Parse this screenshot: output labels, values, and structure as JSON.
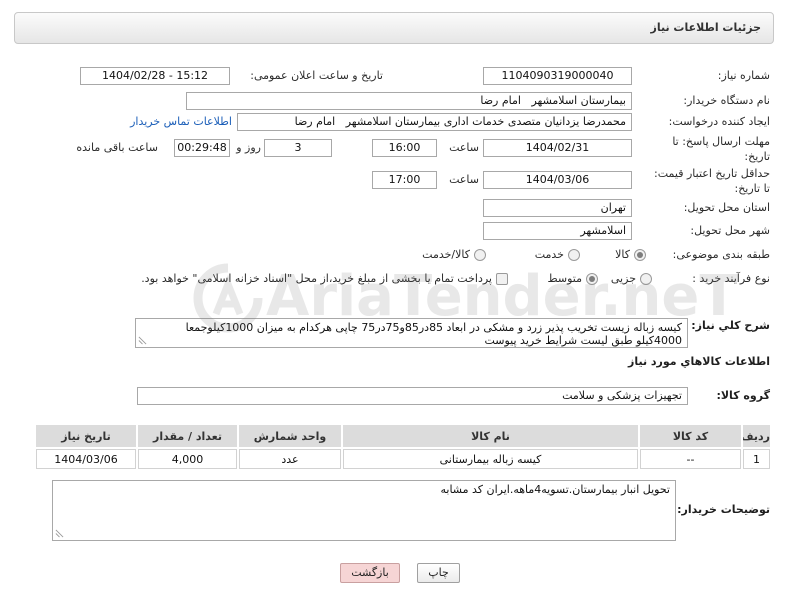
{
  "page": {
    "title": "جزئیات اطلاعات نیاز",
    "watermark": "AriaTender.neT"
  },
  "fields": {
    "need_number": {
      "label": "شماره نیاز:",
      "value": "1104090319000040"
    },
    "announce_datetime": {
      "label": "تاریخ و ساعت اعلان عمومی:",
      "value": "1404/02/28 - 15:12"
    },
    "buyer_org": {
      "label": "نام دستگاه خریدار:",
      "value": "بیمارستان اسلامشهر   امام رضا"
    },
    "requester": {
      "label": "ایجاد کننده درخواست:",
      "value": "محمدرضا یزدانیان متصدی خدمات اداری بیمارستان اسلامشهر   امام رضا",
      "contact_link": "اطلاعات تماس خریدار"
    },
    "reply_deadline": {
      "label_line1": "مهلت ارسال پاسخ: تا",
      "label_line2": "تاریخ:",
      "date": "1404/02/31",
      "time_label": "ساعت",
      "time": "16:00",
      "days": "3",
      "days_label": "روز و",
      "remaining": "00:29:48",
      "remaining_label": "ساعت باقی مانده"
    },
    "price_validity": {
      "label_line1": "حداقل تاریخ اعتبار قیمت:",
      "label_line2": "تا تاریخ:",
      "date": "1404/03/06",
      "time_label": "ساعت",
      "time": "17:00"
    },
    "delivery_province": {
      "label": "استان محل تحویل:",
      "value": "تهران"
    },
    "delivery_city": {
      "label": "شهر محل تحویل:",
      "value": "اسلامشهر"
    },
    "subject_category": {
      "label": "طبقه بندی موضوعی:",
      "options": [
        {
          "label": "کالا",
          "selected": true
        },
        {
          "label": "خدمت",
          "selected": false
        },
        {
          "label": "کالا/خدمت",
          "selected": false
        }
      ]
    },
    "purchase_type": {
      "label": "نوع فرآیند خرید :",
      "options": [
        {
          "label": "جزیی",
          "selected": false
        },
        {
          "label": "متوسط",
          "selected": true
        }
      ],
      "treasury_checkbox": {
        "label": "پرداخت تمام یا بخشی از مبلغ خرید،از محل \"اسناد خزانه اسلامی\" خواهد بود.",
        "checked": false
      }
    },
    "description": {
      "label": "شرح کلي نياز:",
      "value": "کیسه زباله زیست تخریب پذیر زرد و مشکی در ابعاد 85در85و75در75 چاپی هرکدام به میزان 1000کیلوجمعا 4000کیلو طبق لیست شرایط خرید پیوست"
    }
  },
  "goods": {
    "heading": "اطلاعات کالاهاي مورد نياز",
    "group_label": "گروه کالا:",
    "group_value": "تجهیزات پزشکی و سلامت",
    "table": {
      "columns": [
        "ردیف",
        "کد کالا",
        "نام کالا",
        "واحد شمارش",
        "تعداد / مقدار",
        "تاریخ نیاز"
      ],
      "rows": [
        {
          "row": "1",
          "code": "--",
          "name": "کیسه زباله بیمارستانی",
          "unit": "عدد",
          "quantity": "4,000",
          "need_date": "1404/03/06"
        }
      ]
    }
  },
  "buyer_notes": {
    "label": "توضیحات خریدار:",
    "value": "تحویل انبار بیمارستان.تسویه4ماهه.ایران کد مشابه"
  },
  "buttons": {
    "print": "چاپ",
    "back": "بازگشت"
  },
  "colors": {
    "link": "#1b5eb8",
    "back_button_bg": "#f6d5d5",
    "table_header_bg": "#dcdcdc"
  }
}
